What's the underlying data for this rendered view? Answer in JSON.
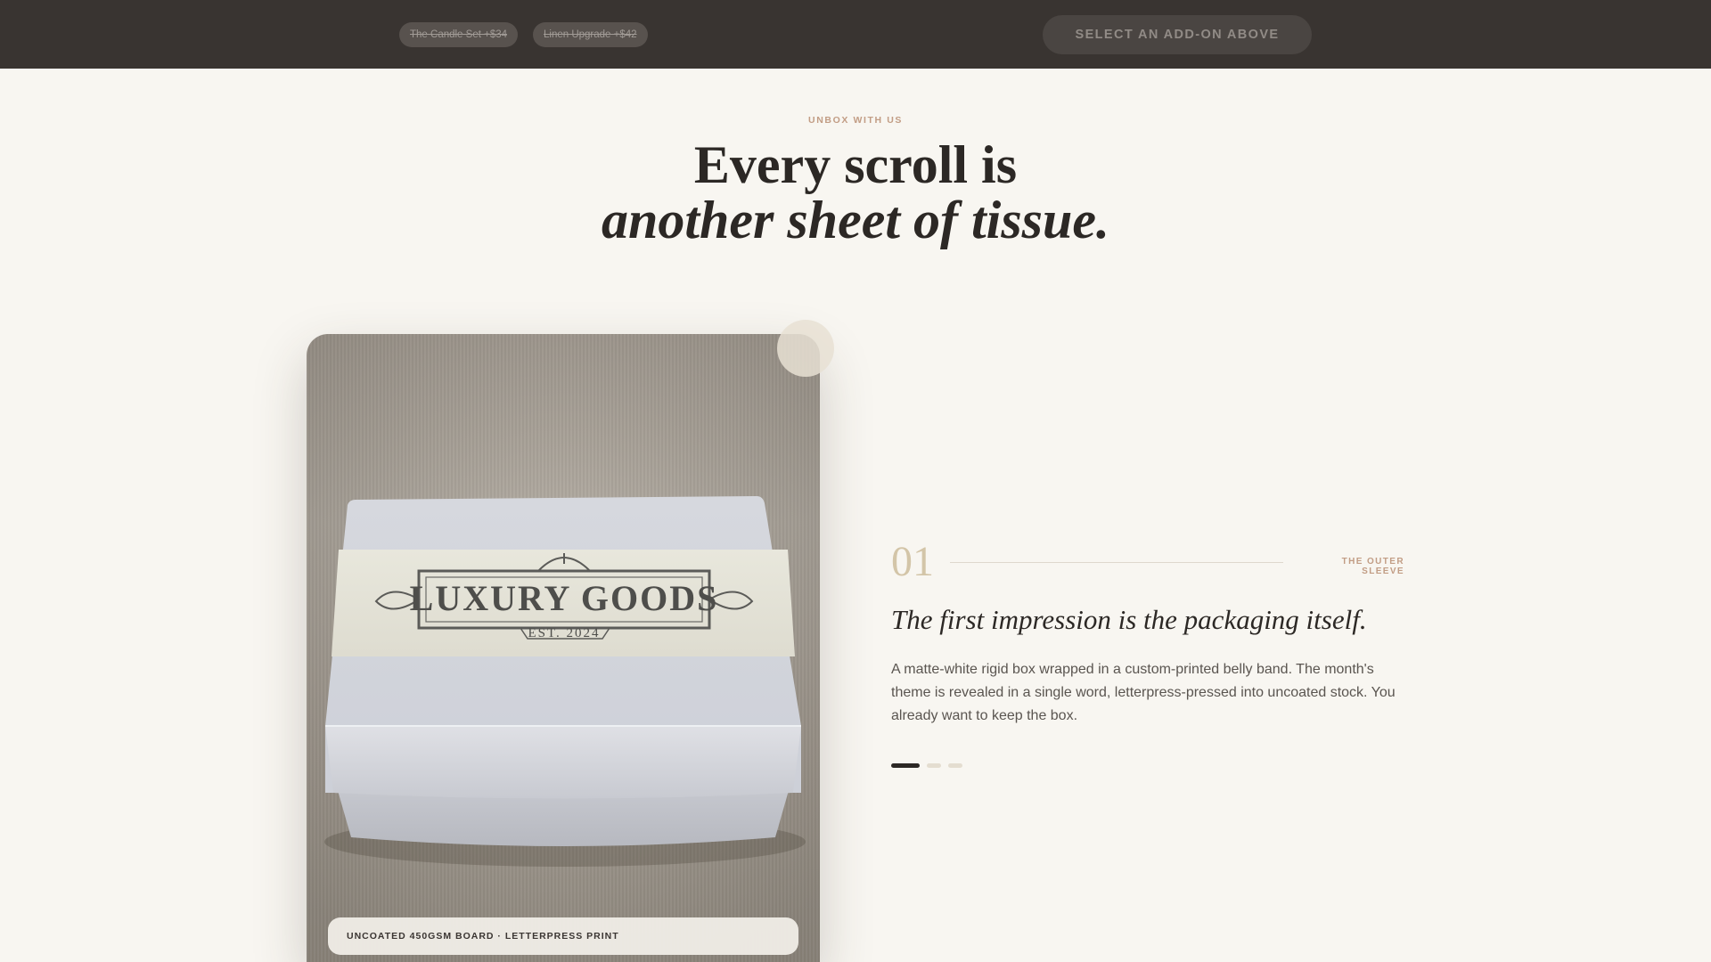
{
  "topbar": {
    "addons": [
      {
        "label": "The Candle Set +$34"
      },
      {
        "label": "Linen Upgrade +$42"
      }
    ],
    "select_label": "SELECT AN ADD-ON ABOVE"
  },
  "hero": {
    "eyebrow": "UNBOX WITH US",
    "headline_line1": "Every scroll is",
    "headline_line2": "another sheet of tissue."
  },
  "image": {
    "caption": "UNCOATED 450GSM BOARD · LETTERPRESS PRINT",
    "band_title": "LUXURY GOODS",
    "band_subtitle": "EST. 2024"
  },
  "step": {
    "number": "01",
    "label": "THE OUTER SLEEVE",
    "title": "The first impression is the packaging itself.",
    "body": "A matte-white rigid box wrapped in a custom-printed belly band. The month's theme is revealed in a single word, letterpress-pressed into uncoated stock. You already want to keep the box.",
    "current": 1,
    "total": 3
  },
  "colors": {
    "topbar_bg": "#393431",
    "page_bg": "#f8f6f1",
    "accent": "#c29d85",
    "step_number": "#d3c5a8",
    "text_dark": "#2c2825"
  }
}
